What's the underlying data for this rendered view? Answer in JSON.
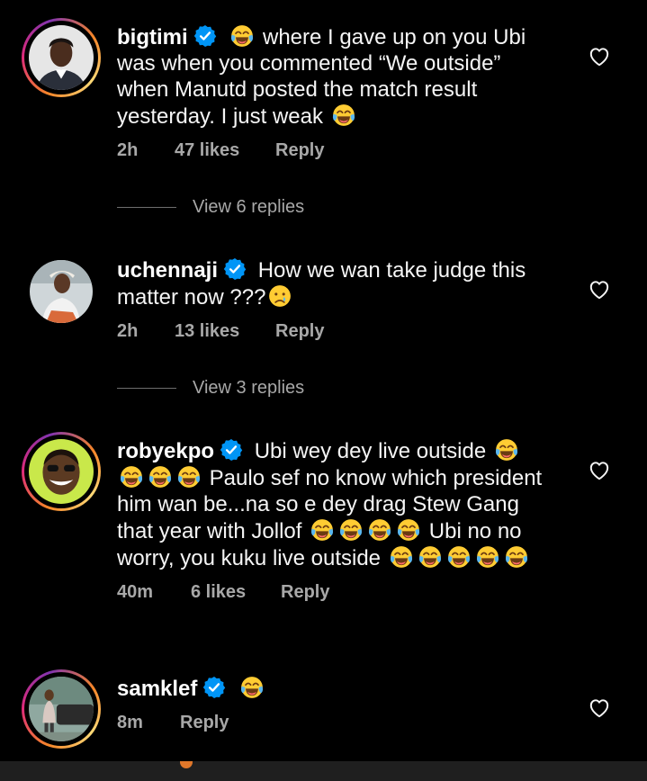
{
  "comments": [
    {
      "username": "bigtimi",
      "text_parts": [
        "where I gave up on you Ubi was when you commented “We outside” when Manutd posted the match result yesterday. I just weak"
      ],
      "time": "2h",
      "likes": "47 likes",
      "reply": "Reply",
      "view_replies": "View 6 replies",
      "avatar_ring": "story"
    },
    {
      "username": "uchennaji",
      "text_parts": [
        "How we wan take judge this matter now ???"
      ],
      "time": "2h",
      "likes": "13 likes",
      "reply": "Reply",
      "view_replies": "View 3 replies",
      "avatar_ring": "none"
    },
    {
      "username": "robyekpo",
      "text_parts": [
        "Ubi wey dey live outside",
        "Paulo sef no know which president him wan be...na so e dey drag Stew Gang that year with Jollof",
        "Ubi no no worry, you kuku live outside"
      ],
      "time": "40m",
      "likes": "6 likes",
      "reply": "Reply",
      "avatar_ring": "story"
    },
    {
      "username": "samklef",
      "text_parts": [],
      "time": "8m",
      "reply": "Reply",
      "avatar_ring": "story"
    }
  ],
  "icons": {
    "verified": "verified-badge-icon",
    "heart": "heart-outline-icon",
    "laugh_emoji": "face-with-tears-of-joy-emoji",
    "cry_emoji": "crying-face-emoji"
  },
  "colors": {
    "background": "#000000",
    "text": "#f5f5f5",
    "secondary": "#a8a8a8",
    "verified": "#0095f6",
    "story_ring": "#dd2a7b"
  }
}
